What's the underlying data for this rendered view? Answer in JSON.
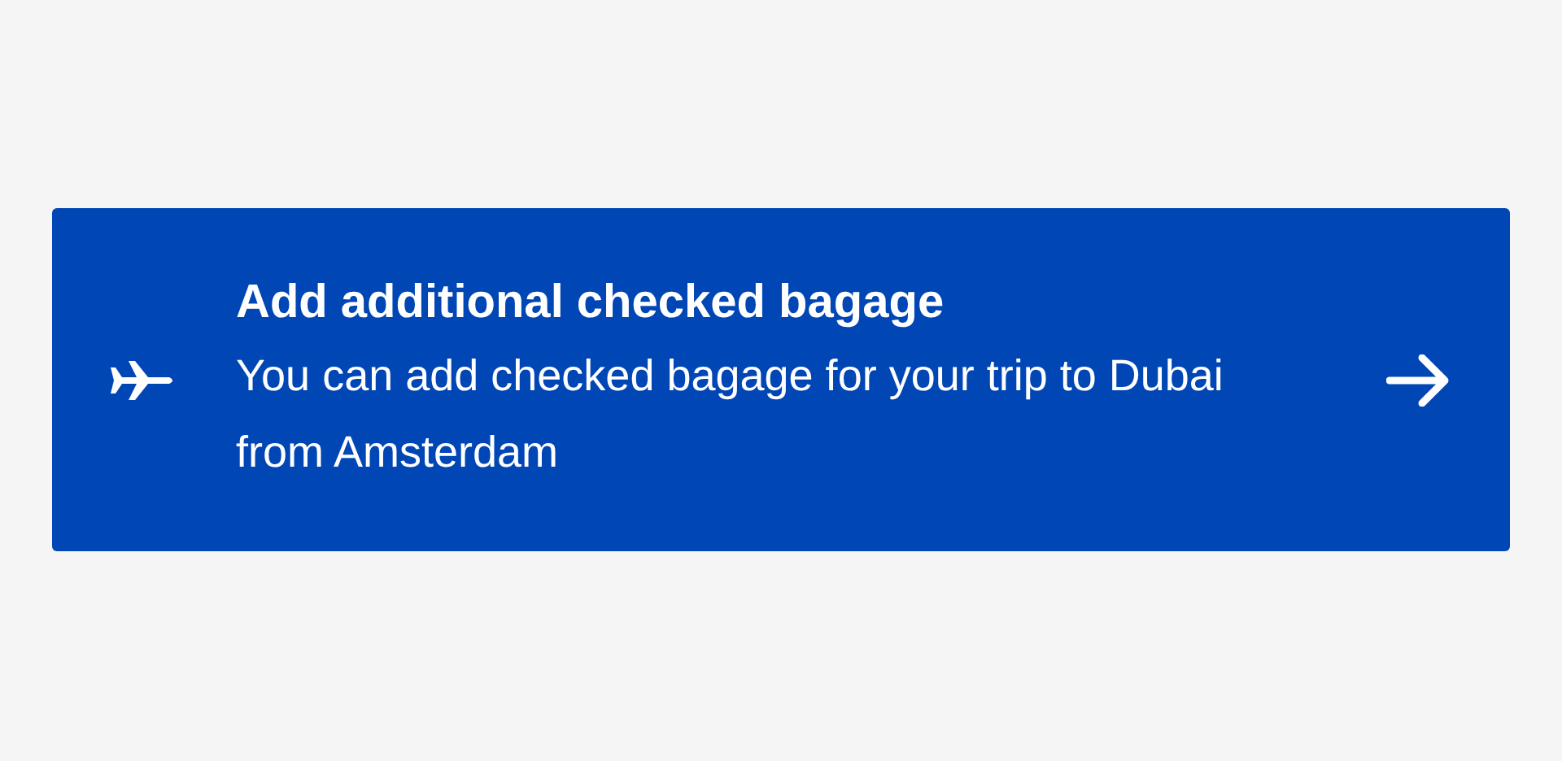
{
  "banner": {
    "title": "Add additional checked bagage",
    "description": "You can add checked bagage for your trip to Dubai from Amsterdam"
  }
}
